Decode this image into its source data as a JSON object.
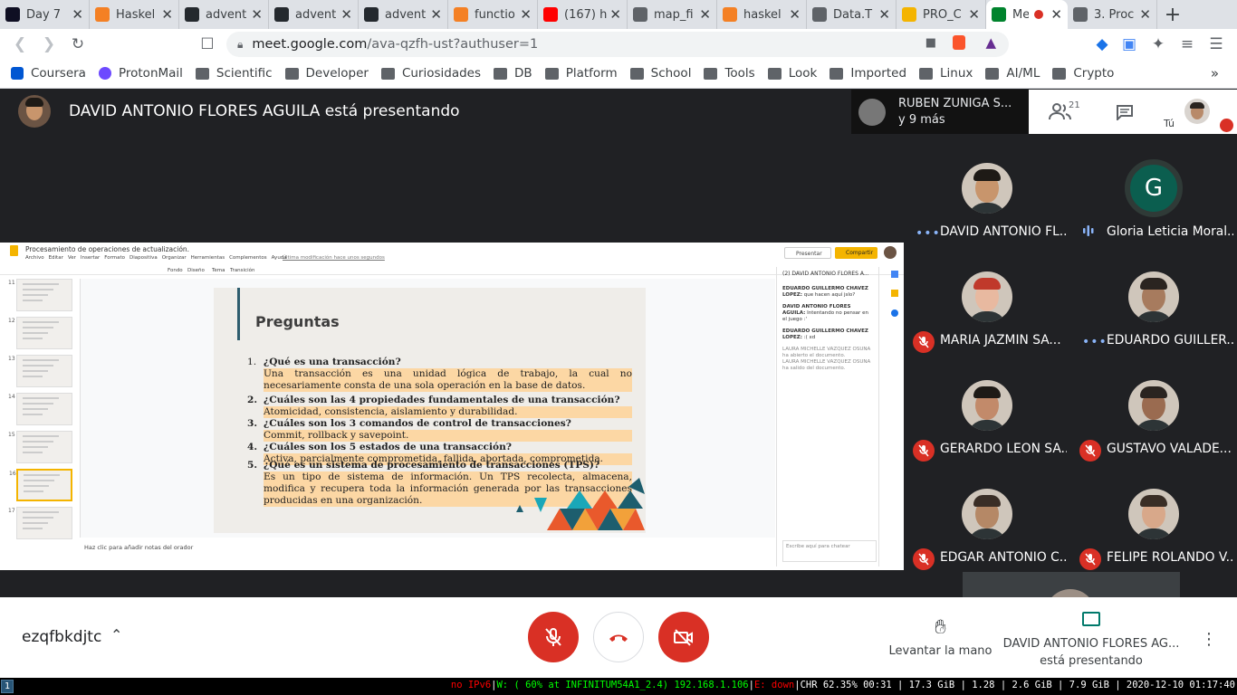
{
  "tabs": [
    {
      "title": "Day 7",
      "icon": "aoc-star-icon",
      "color": "#0f0f23"
    },
    {
      "title": "Haskel",
      "icon": "stackoverflow-icon",
      "color": "#f48024"
    },
    {
      "title": "advent",
      "icon": "github-icon",
      "color": "#24292e"
    },
    {
      "title": "advent",
      "icon": "github-icon",
      "color": "#24292e"
    },
    {
      "title": "advent",
      "icon": "github-icon",
      "color": "#24292e"
    },
    {
      "title": "functio",
      "icon": "stackoverflow-icon",
      "color": "#f48024"
    },
    {
      "title": "(167) h",
      "icon": "youtube-icon",
      "color": "#ff0000"
    },
    {
      "title": "map_fi",
      "icon": "globe-icon",
      "color": "#5f6368"
    },
    {
      "title": "haskel",
      "icon": "stackoverflow-icon",
      "color": "#f48024"
    },
    {
      "title": "Data.T",
      "icon": "globe-icon",
      "color": "#5f6368"
    },
    {
      "title": "PRO_C",
      "icon": "slides-icon",
      "color": "#f4b400"
    },
    {
      "title": "Me",
      "icon": "meet-icon",
      "color": "#00832d"
    },
    {
      "title": "3. Proc",
      "icon": "globe-icon",
      "color": "#5f6368"
    }
  ],
  "url": {
    "host": "meet.google.com",
    "path": "/ava-qzfh-ust?authuser=1"
  },
  "bookmarks": [
    "Coursera",
    "ProtonMail",
    "Scientific",
    "Developer",
    "Curiosidades",
    "DB",
    "Platform",
    "School",
    "Tools",
    "Look",
    "Imported",
    "Linux",
    "AI/ML",
    "Crypto"
  ],
  "meet": {
    "presenter_banner": "DAVID ANTONIO FLORES AGUILA está presentando",
    "preview_name": "RUBEN ZUNIGA S...",
    "preview_more": "y 9 más",
    "participant_count": "21",
    "self_label": "Tú",
    "participants": [
      {
        "name": "DAVID ANTONIO FL...",
        "status": "speaking"
      },
      {
        "name": "Gloria Leticia Moral...",
        "status": "audio",
        "initial": "G"
      },
      {
        "name": "MARIA JAZMIN SA...",
        "status": "muted"
      },
      {
        "name": "EDUARDO GUILLER...",
        "status": "speaking"
      },
      {
        "name": "GERARDO LEON SA...",
        "status": "muted"
      },
      {
        "name": "GUSTAVO VALADE...",
        "status": "muted"
      },
      {
        "name": "EDGAR ANTONIO C...",
        "status": "muted"
      },
      {
        "name": "FELIPE ROLANDO V...",
        "status": "muted"
      }
    ],
    "meeting_code": "ezqfbkdjtc",
    "raise_hand": "Levantar la mano",
    "presenting_name": "DAVID ANTONIO FLORES AG...",
    "presenting_suffix": "está presentando"
  },
  "slides": {
    "doc_title": "Procesamiento de operaciones de actualización.",
    "menu": [
      "Archivo",
      "Editar",
      "Ver",
      "Insertar",
      "Formato",
      "Diapositiva",
      "Organizar",
      "Herramientas",
      "Complementos",
      "Ayuda"
    ],
    "last_edit": "Última modificación hace unos segundos",
    "present_label": "Presentar",
    "share_label": "Compartir",
    "toolbar_items": [
      "Fondo",
      "Diseño",
      "Tema",
      "Transición"
    ],
    "speaker_notes": "Haz clic para añadir notas del orador",
    "slide_title": "Preguntas",
    "questions": [
      {
        "n": "1.",
        "q": "¿Qué es una transacción?",
        "a": "Una transacción es una unidad lógica de trabajo, la cual no necesariamente consta de una sola operación en la base de datos."
      },
      {
        "n": "2.",
        "q": "¿Cuáles son las 4 propiedades fundamentales de una transacción?",
        "a": "Atomicidad, consistencia, aislamiento y durabilidad."
      },
      {
        "n": "3.",
        "q": "¿Cuáles son los 3 comandos de control de transacciones?",
        "a": "Commit, rollback y savepoint."
      },
      {
        "n": "4.",
        "q": "¿Cuáles son los 5 estados de una transacción?",
        "a": "Activa, parcialmente comprometida, fallida, abortada, comprometida."
      },
      {
        "n": "5.",
        "q": "¿Qué es un sistema de procesamiento de transacciones (TPS)?",
        "a": "Es un tipo de sistema de información. Un TPS recolecta, almacena, modifica y recupera toda la información generada por las transacciones producidas en una organización."
      }
    ],
    "thumb_numbers": [
      "11",
      "12",
      "13",
      "14",
      "15",
      "16",
      "17"
    ],
    "chat_header": "(2) DAVID ANTONIO FLORES A...",
    "chat_messages": [
      {
        "who": "EDUARDO GUILLERMO CHAVEZ LOPEZ:",
        "text": "que hacen aquí jslo?"
      },
      {
        "who": "DAVID ANTONIO FLORES AGUILA:",
        "text": "Intentando no pensar en el juego :'"
      },
      {
        "who": "EDUARDO GUILLERMO CHAVEZ LOPEZ:",
        "text": ":( xd"
      }
    ],
    "chat_events": [
      "LAURA MICHELLE VAZQUEZ OSUNA ha abierto el documento.",
      "LAURA MICHELLE VAZQUEZ OSUNA ha salido del documento."
    ],
    "chat_placeholder": "Escribe aquí para chatear"
  },
  "statusbar": {
    "workspace": "1",
    "ipv6": "no IPv6",
    "wifi": "W: ( 60% at INFINITUM54A1_2.4) 192.168.1.106",
    "eth": "E: down",
    "rest": "CHR 62.35% 00:31 | 17.3 GiB | 1.28 | 2.6 GiB | 7.9 GiB | 2020-12-10 01:17:40"
  }
}
